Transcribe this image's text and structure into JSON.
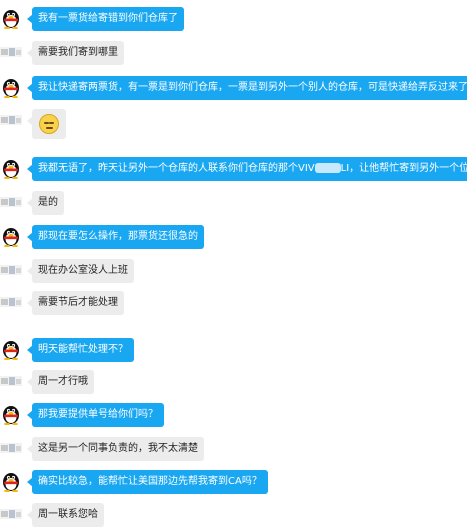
{
  "messages": [
    {
      "side": "mine",
      "text": "我有一票货给寄错到你们仓库了"
    },
    {
      "side": "theirs",
      "text": "需要我们寄到哪里"
    },
    {
      "side": "mine",
      "text": "我让快递寄两票货，有一票是到你们仓库，一票是到另外一个别人的仓库，可是快递给弄反过来了"
    },
    {
      "side": "theirs",
      "emoji": "grimace-emoji"
    },
    {
      "side": "mine",
      "text_a": "我都无语了，昨天让另外一个仓库的人联系你们仓库的那个VIV",
      "text_b": "LI，让他帮忙寄到另外一个位于CA"
    },
    {
      "side": "theirs",
      "text": "是的"
    },
    {
      "side": "mine",
      "text": "那现在要怎么操作，那票货还很急的"
    },
    {
      "side": "theirs",
      "text": "现在办公室没人上班"
    },
    {
      "side": "theirs",
      "text": "需要节后才能处理"
    },
    {
      "side": "mine",
      "text": "明天能帮忙处理不？"
    },
    {
      "side": "theirs",
      "text": "周一才行哦"
    },
    {
      "side": "mine",
      "text": "那我要提供单号给你们吗？"
    },
    {
      "side": "theirs",
      "text": "这是另一个同事负责的，我不太清楚"
    },
    {
      "side": "mine",
      "text": "确实比较急，能帮忙让美国那边先帮我寄到CA吗？"
    },
    {
      "side": "theirs",
      "text": "周一联系您哈"
    }
  ]
}
